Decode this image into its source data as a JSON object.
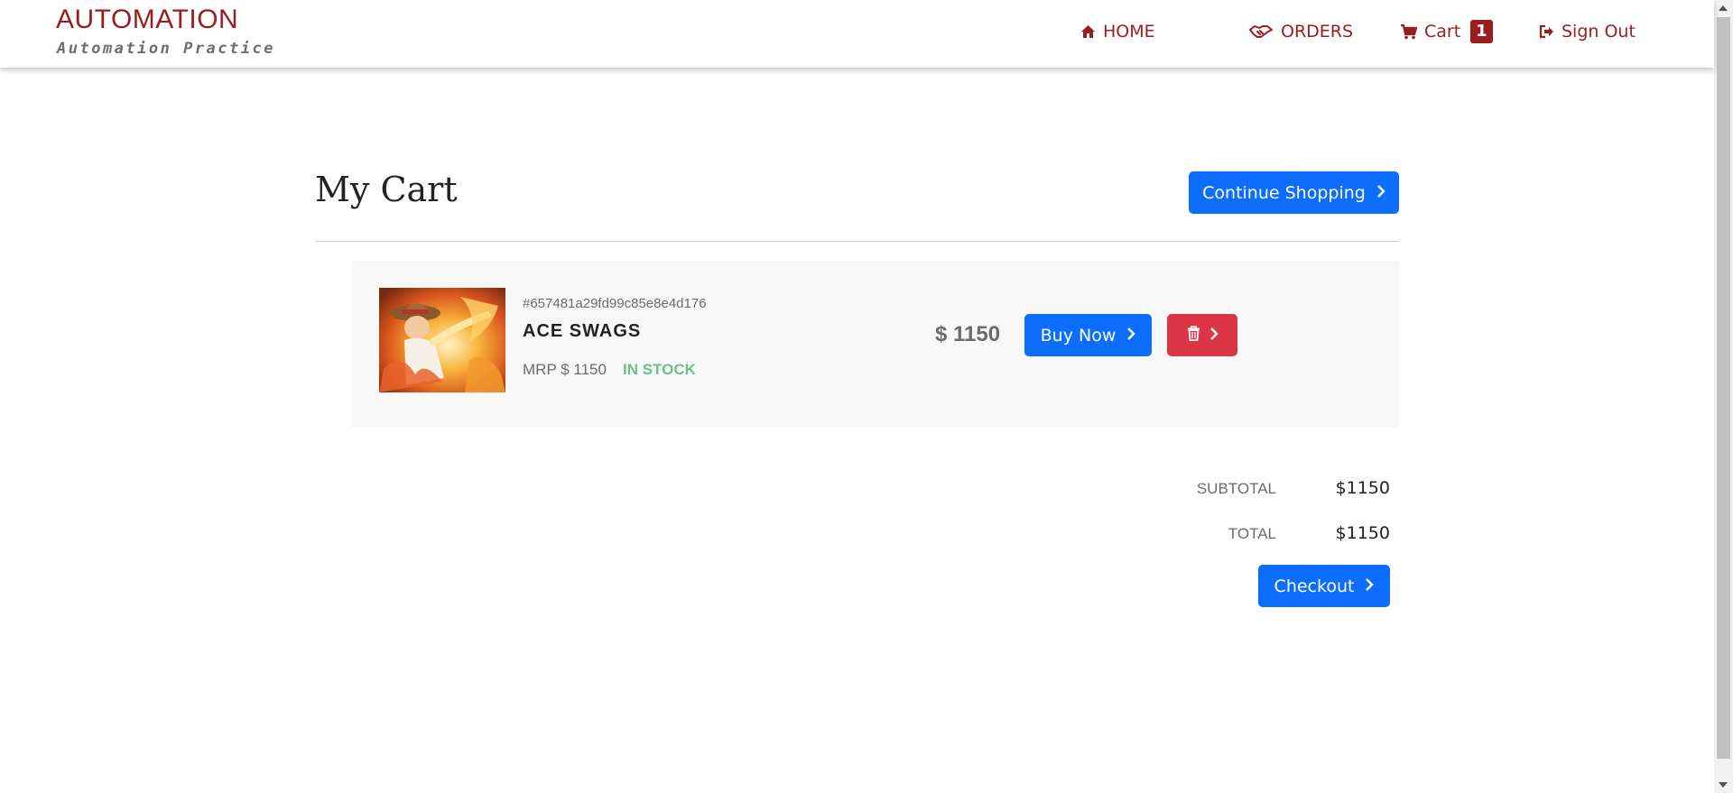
{
  "brand": {
    "title": "AUTOMATION",
    "subtitle": "Automation Practice"
  },
  "nav": {
    "home": "HOME",
    "orders": "ORDERS",
    "cart": "Cart",
    "cart_count": "1",
    "signout": "Sign Out"
  },
  "page": {
    "title": "My Cart",
    "continue_label": "Continue Shopping"
  },
  "item": {
    "id": "#657481a29fd99c85e8e4d176",
    "name": "ACE SWAGS",
    "mrp": "MRP $ 1150",
    "stock": "IN STOCK",
    "price": "$ 1150",
    "buy_label": "Buy Now"
  },
  "summary": {
    "subtotal_label": "SUBTOTAL",
    "subtotal_value": "$1150",
    "total_label": "TOTAL",
    "total_value": "$1150",
    "checkout_label": "Checkout"
  },
  "colors": {
    "brand": "#9b1c1c",
    "primary": "#0d6efd",
    "danger": "#dc3545",
    "in_stock": "#6cc18a",
    "card_bg": "#f8f8f8"
  },
  "icons": {
    "home": "home-icon",
    "orders": "handshake-icon",
    "cart": "cart-icon",
    "signout": "sign-out-icon",
    "chevron": "chevron-right-icon",
    "delete": "trash-icon"
  }
}
